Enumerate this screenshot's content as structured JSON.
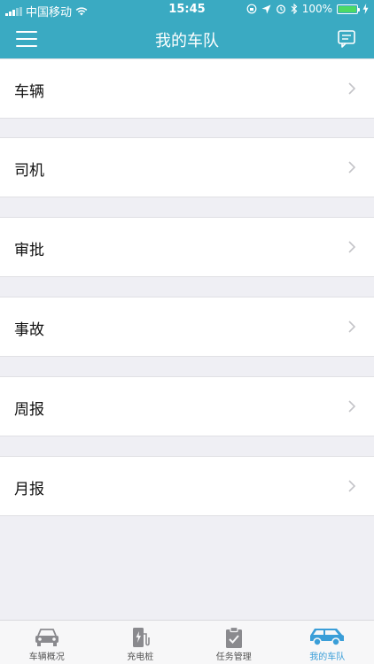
{
  "status_bar": {
    "carrier": "中国移动",
    "time": "15:45",
    "battery": "100%"
  },
  "nav": {
    "title": "我的车队"
  },
  "menu_items": [
    {
      "label": "车辆"
    },
    {
      "label": "司机"
    },
    {
      "label": "审批"
    },
    {
      "label": "事故"
    },
    {
      "label": "周报"
    },
    {
      "label": "月报"
    }
  ],
  "tabs": [
    {
      "label": "车辆概况",
      "icon": "car-front-icon"
    },
    {
      "label": "充电桩",
      "icon": "charging-pile-icon"
    },
    {
      "label": "任务管理",
      "icon": "clipboard-check-icon"
    },
    {
      "label": "我的车队",
      "icon": "suv-icon",
      "active": true
    }
  ],
  "colors": {
    "header": "#3aaac2",
    "active_tab": "#3a9ed8",
    "background": "#efeff4"
  }
}
